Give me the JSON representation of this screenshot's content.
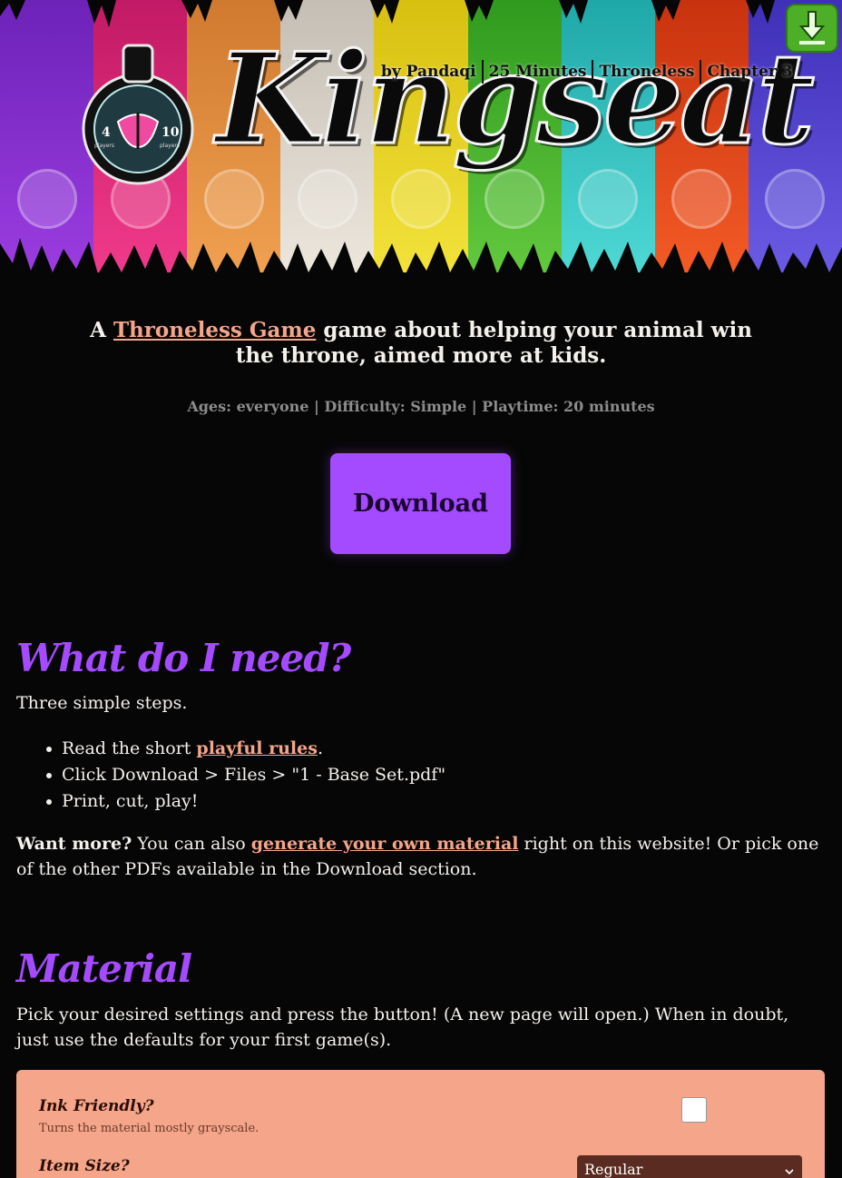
{
  "header": {
    "title": "Kingseat",
    "subtitle_items": [
      "by Pandaqi",
      "25 Minutes",
      "Throneless",
      "Chapter 3"
    ],
    "badge": {
      "min_players": "4",
      "min_label": "players",
      "max_players": "10",
      "max_label": "players"
    },
    "stripe_colors": [
      "#8a2fc9",
      "#e0287a",
      "#e08a3a",
      "#d8d2c8",
      "#e6d420",
      "#4cb830",
      "#30c2c0",
      "#e04a1c",
      "#5a4ad8"
    ],
    "corner_icon": "download-arrow-icon"
  },
  "intro": {
    "prefix": "A ",
    "link": "Throneless Game",
    "suffix_line1": " game about helping your animal win",
    "line2": "the throne, aimed more at kids."
  },
  "meta": "Ages: everyone | Difficulty: Simple | Playtime: 20 minutes",
  "download_button": "Download",
  "need_section": {
    "heading": "What do I need?",
    "intro": "Three simple steps.",
    "steps": [
      {
        "before": "Read the short ",
        "link": "playful rules",
        "after": "."
      },
      {
        "text": "Click Download > Files > \"1 - Base Set.pdf\""
      },
      {
        "text": "Print, cut, play!"
      }
    ],
    "more_bold": "Want more?",
    "more_before": " You can also ",
    "more_link": "generate your own material",
    "more_after": " right on this website! Or pick one of the other PDFs available in the Download section."
  },
  "material_section": {
    "heading": "Material",
    "intro": "Pick your desired settings and press the button! (A new page will open.) When in doubt, just use the defaults for your first game(s).",
    "settings": [
      {
        "label": "Ink Friendly?",
        "help": "Turns the material mostly grayscale.",
        "checked": false
      },
      {
        "label": "Item Size?",
        "value": "Regular"
      }
    ]
  },
  "colors": {
    "accent": "#a44bff",
    "link": "#f4a58a",
    "panel": "#f4a58a",
    "background": "#060606"
  }
}
